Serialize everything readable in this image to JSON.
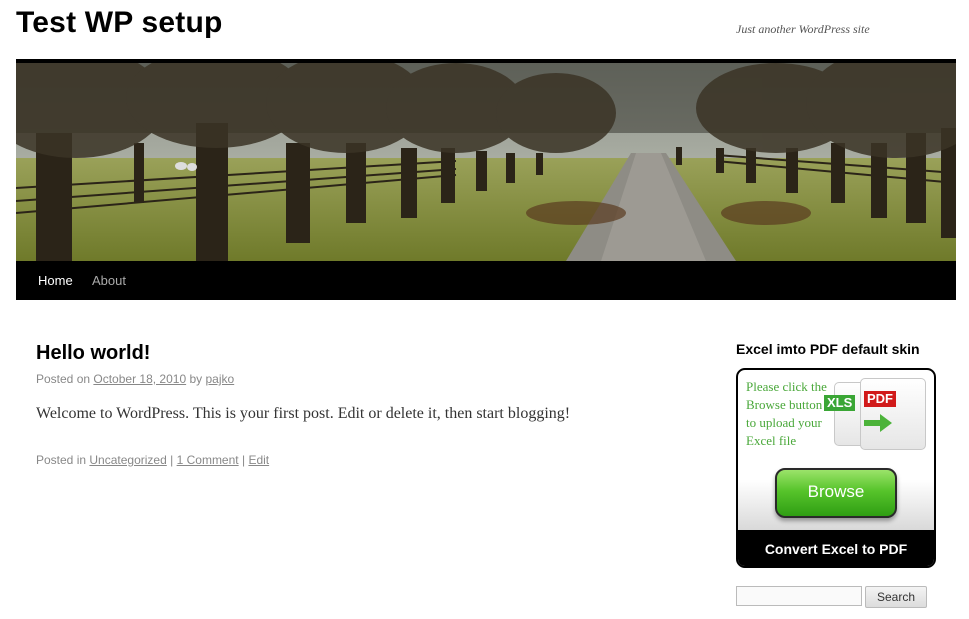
{
  "site": {
    "title": "Test WP setup",
    "description": "Just another WordPress site"
  },
  "nav": {
    "items": [
      {
        "label": "Home",
        "current": true
      },
      {
        "label": "About",
        "current": false
      }
    ]
  },
  "post": {
    "title": "Hello world!",
    "meta": {
      "posted_on": "Posted on",
      "date": "October 18, 2010",
      "by": "by",
      "author": "pajko"
    },
    "content": "Welcome to WordPress. This is your first post. Edit or delete it, then start blogging!",
    "utility": {
      "posted_in": "Posted in",
      "category": "Uncategorized",
      "sep1": "|",
      "comments": "1 Comment",
      "sep2": "|",
      "edit": "Edit"
    }
  },
  "sidebar": {
    "widget_title": "Excel imto PDF default skin",
    "excel_widget": {
      "instructions": "Please click the Browse button to upload your Excel file",
      "xls_badge": "XLS",
      "pdf_badge": "PDF",
      "browse_label": "Browse",
      "footer_label": "Convert Excel to PDF"
    },
    "search": {
      "placeholder": "",
      "button_label": "Search"
    }
  },
  "colors": {
    "nav_bg": "#000000",
    "widget_text": "#4aa83a",
    "browse_green": "#57c42b",
    "xls_badge": "#3aa635",
    "pdf_badge": "#d11a1a"
  }
}
